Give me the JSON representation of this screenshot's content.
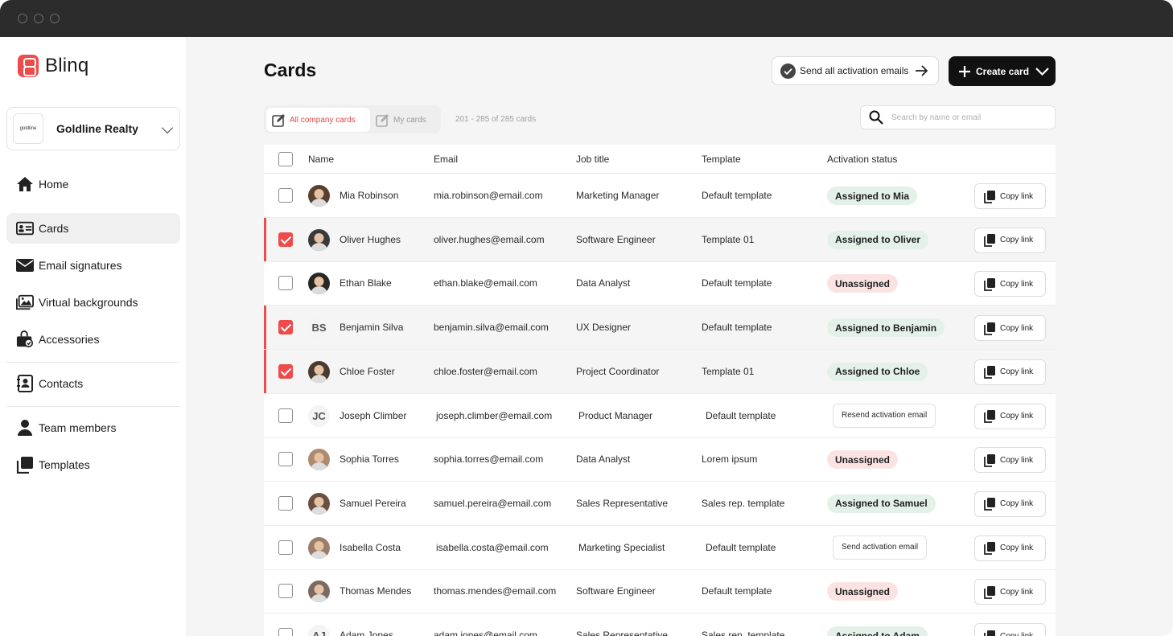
{
  "app": {
    "name": "Blinq"
  },
  "company": {
    "name": "Goldline Realty",
    "logo_text": "goldline"
  },
  "nav": [
    {
      "label": "Home",
      "icon": "home-icon"
    },
    {
      "label": "Cards",
      "icon": "id-card-icon",
      "active": true
    },
    {
      "label": "Email signatures",
      "icon": "envelope-icon"
    },
    {
      "label": "Virtual backgrounds",
      "icon": "image-icon"
    },
    {
      "label": "Accessories",
      "icon": "shopping-bag-icon"
    },
    {
      "label": "Contacts",
      "icon": "contact-book-icon"
    },
    {
      "label": "Team members",
      "icon": "person-icon"
    },
    {
      "label": "Templates",
      "icon": "template-icon"
    }
  ],
  "header": {
    "title": "Cards",
    "send_all_label": "Send all activation emails",
    "create_label": "Create card"
  },
  "tabs": [
    {
      "label": "All company cards",
      "active": true
    },
    {
      "label": "My cards",
      "active": false
    }
  ],
  "count_text": "201 - 285 of 285 cards",
  "search": {
    "placeholder": "Search by name or email"
  },
  "table": {
    "columns": [
      "Name",
      "Email",
      "Job title",
      "Template",
      "Activation status"
    ],
    "copy_label": "Copy link",
    "rows": [
      {
        "name": "Mia Robinson",
        "email": "mia.robinson@email.com",
        "job": "Marketing Manager",
        "template": "Default template",
        "status": "Assigned to Mia",
        "status_type": "assigned",
        "checked": false,
        "initials": "",
        "avatar_color": "#5a4030"
      },
      {
        "name": "Oliver Hughes",
        "email": "oliver.hughes@email.com",
        "job": "Software Engineer",
        "template": "Template 01",
        "status": "Assigned to Oliver",
        "status_type": "assigned",
        "checked": true,
        "initials": "",
        "avatar_color": "#3a3a3a"
      },
      {
        "name": "Ethan Blake",
        "email": "ethan.blake@email.com",
        "job": "Data Analyst",
        "template": "Default template",
        "status": "Unassigned",
        "status_type": "unassigned",
        "checked": false,
        "initials": "",
        "avatar_color": "#2a2622"
      },
      {
        "name": "Benjamin Silva",
        "email": "benjamin.silva@email.com",
        "job": "UX Designer",
        "template": "Default template",
        "status": "Assigned to Benjamin",
        "status_type": "assigned",
        "checked": true,
        "initials": "BS",
        "avatar_color": ""
      },
      {
        "name": "Chloe Foster",
        "email": "chloe.foster@email.com",
        "job": "Project Coordinator",
        "template": "Template 01",
        "status": "Assigned to Chloe",
        "status_type": "assigned",
        "checked": true,
        "initials": "",
        "avatar_color": "#4a3a30"
      },
      {
        "name": "Joseph Climber",
        "email": "joseph.climber@email.com",
        "job": "Product Manager",
        "template": "Default template",
        "status": "Resend activation email",
        "status_type": "action",
        "checked": false,
        "initials": "JC",
        "avatar_color": ""
      },
      {
        "name": "Sophia Torres",
        "email": "sophia.torres@email.com",
        "job": "Data Analyst",
        "template": "Lorem ipsum",
        "status": "Unassigned",
        "status_type": "unassigned",
        "checked": false,
        "initials": "",
        "avatar_color": "#b08a70"
      },
      {
        "name": "Samuel Pereira",
        "email": "samuel.pereira@email.com",
        "job": "Sales Representative",
        "template": "Sales rep. template",
        "status": "Assigned to Samuel",
        "status_type": "assigned",
        "checked": false,
        "initials": "",
        "avatar_color": "#6a5040"
      },
      {
        "name": "Isabella Costa",
        "email": "isabella.costa@email.com",
        "job": "Marketing Specialist",
        "template": "Default template",
        "status": "Send activation email",
        "status_type": "action",
        "checked": false,
        "initials": "",
        "avatar_color": "#9a7e6a"
      },
      {
        "name": "Thomas Mendes",
        "email": "thomas.mendes@email.com",
        "job": "Software Engineer",
        "template": "Default template",
        "status": "Unassigned",
        "status_type": "unassigned",
        "checked": false,
        "initials": "",
        "avatar_color": "#7a6a60"
      },
      {
        "name": "Adam Jones",
        "email": "adam.jones@email.com",
        "job": "Sales Representative",
        "template": "Sales rep. template",
        "status": "Assigned to Adam",
        "status_type": "assigned",
        "checked": false,
        "initials": "AJ",
        "avatar_color": ""
      }
    ]
  },
  "colors": {
    "accent": "#ef4b4b",
    "assigned_bg": "#e3f1e8",
    "unassigned_bg": "#fbe3e3",
    "dark_button": "#111111"
  }
}
